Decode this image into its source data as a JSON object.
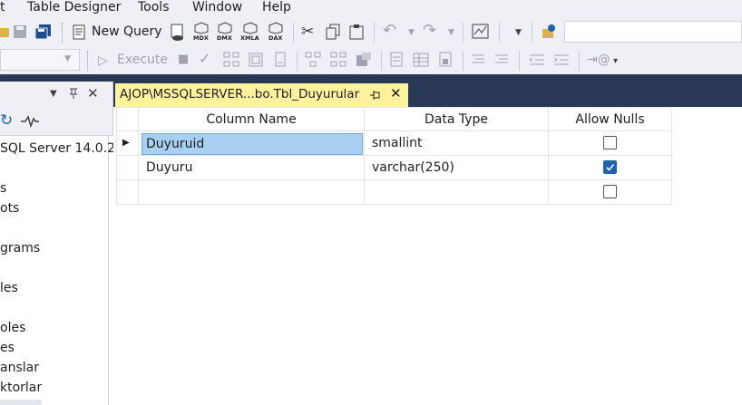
{
  "menu": {
    "items": [
      "t",
      "Table Designer",
      "Tools",
      "Window",
      "Help"
    ]
  },
  "toolbar": {
    "new_query_label": "New Query",
    "execute_label": "Execute",
    "mdx_label": "MDX",
    "dmx_label": "DMX",
    "xmla_label": "XMLA",
    "dax_label": "DAX"
  },
  "object_explorer": {
    "pin_glyph": "▼ ⊥ ✕",
    "tree": [
      "SQL Server 14.0.2",
      "s",
      "ots",
      "grams",
      "les",
      "oles",
      "es",
      "anslar",
      "ktorlar"
    ]
  },
  "document": {
    "tab_title": "AJOP\\MSSQLSERVER...bo.Tbl_Duyurular"
  },
  "table_designer": {
    "columns": [
      "Column Name",
      "Data Type",
      "Allow Nulls"
    ],
    "rows": [
      {
        "name": "Duyuruid",
        "type": "smallint",
        "allow_nulls": false,
        "current": true
      },
      {
        "name": "Duyuru",
        "type": "varchar(250)",
        "allow_nulls": true,
        "current": false
      },
      {
        "name": "",
        "type": "",
        "allow_nulls": false,
        "current": false
      }
    ]
  },
  "colors": {
    "accent": "#293955",
    "active_tab": "#fff29d",
    "selection": "#a8d0f0",
    "checkbox_checked": "#1f63b5"
  }
}
